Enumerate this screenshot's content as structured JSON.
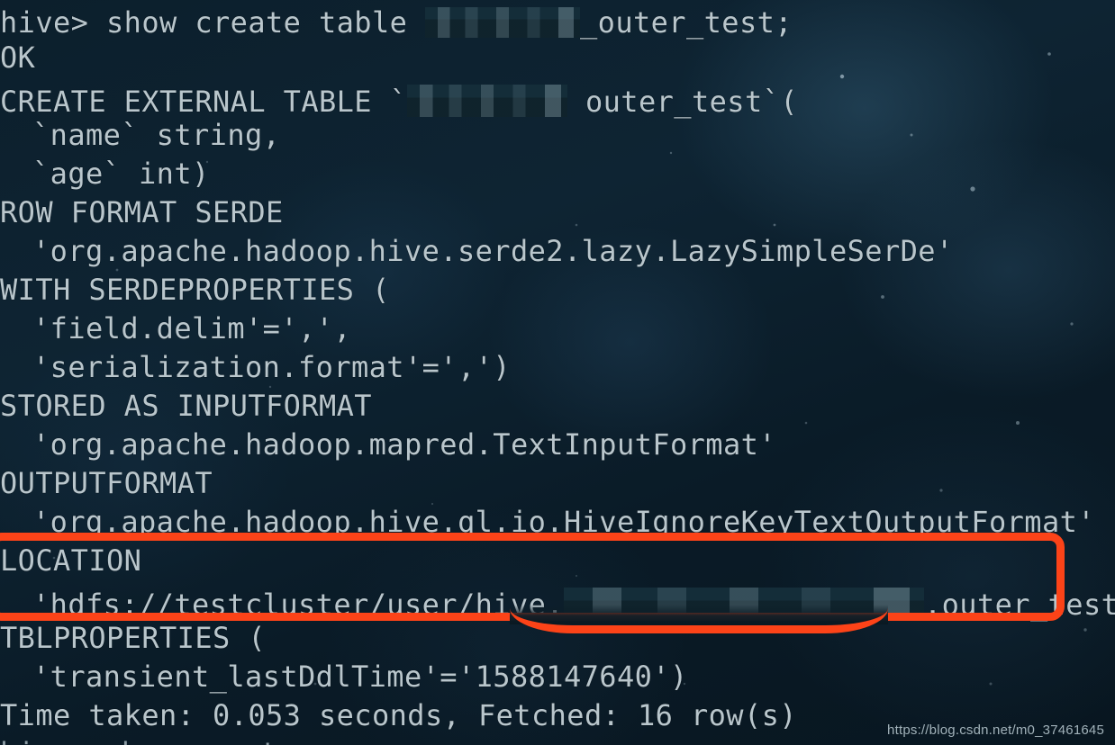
{
  "terminal": {
    "prompt": "hive> ",
    "lines": [
      {
        "id": "cmd-show-create",
        "indent": false,
        "pre": "hive> show create table ",
        "redacted": "m1",
        "post": "_outer_test;"
      },
      {
        "id": "result-ok",
        "indent": false,
        "pre": "OK",
        "redacted": null,
        "post": ""
      },
      {
        "id": "create-external-table",
        "indent": false,
        "pre": "CREATE EXTERNAL TABLE `",
        "redacted": "m2",
        "post": " outer_test`("
      },
      {
        "id": "col-name",
        "indent": true,
        "pre": "`name` string,",
        "redacted": null,
        "post": ""
      },
      {
        "id": "col-age",
        "indent": true,
        "pre": "`age` int)",
        "redacted": null,
        "post": ""
      },
      {
        "id": "row-format-serde",
        "indent": false,
        "pre": "ROW FORMAT SERDE",
        "redacted": null,
        "post": ""
      },
      {
        "id": "serde-class",
        "indent": true,
        "pre": "'org.apache.hadoop.hive.serde2.lazy.LazySimpleSerDe'",
        "redacted": null,
        "post": ""
      },
      {
        "id": "with-serdeproperties",
        "indent": false,
        "pre": "WITH SERDEPROPERTIES (",
        "redacted": null,
        "post": ""
      },
      {
        "id": "prop-field-delim",
        "indent": true,
        "pre": "'field.delim'=',',",
        "redacted": null,
        "post": ""
      },
      {
        "id": "prop-serialization-format",
        "indent": true,
        "pre": "'serialization.format'=',')",
        "redacted": null,
        "post": ""
      },
      {
        "id": "stored-as-inputformat",
        "indent": false,
        "pre": "STORED AS INPUTFORMAT",
        "redacted": null,
        "post": ""
      },
      {
        "id": "inputformat-class",
        "indent": true,
        "pre": "'org.apache.hadoop.mapred.TextInputFormat'",
        "redacted": null,
        "post": ""
      },
      {
        "id": "outputformat",
        "indent": false,
        "pre": "OUTPUTFORMAT",
        "redacted": null,
        "post": ""
      },
      {
        "id": "outputformat-class",
        "indent": true,
        "pre": "'org.apache.hadoop.hive.ql.io.HiveIgnoreKeyTextOutputFormat'",
        "redacted": null,
        "post": ""
      },
      {
        "id": "location-keyword",
        "indent": false,
        "pre": "LOCATION",
        "redacted": null,
        "post": ""
      },
      {
        "id": "location-path",
        "indent": true,
        "pre": "'hdfs://testcluster/user/hive,",
        "redacted": "m3",
        "post": ".outer_test'"
      },
      {
        "id": "tblproperties",
        "indent": false,
        "pre": "TBLPROPERTIES (",
        "redacted": null,
        "post": ""
      },
      {
        "id": "prop-transient-lastddltime",
        "indent": true,
        "pre": "'transient_lastDdlTime'='1588147640')",
        "redacted": null,
        "post": ""
      },
      {
        "id": "time-taken",
        "indent": false,
        "pre": "Time taken: 0.053 seconds, Fetched: 16 row(s)",
        "redacted": null,
        "post": ""
      }
    ],
    "cutoff_line": "hive> show create"
  },
  "highlight": {
    "label": "location-highlight",
    "color": "#fc4318"
  },
  "watermark": {
    "text": "https://blog.csdn.net/m0_37461645"
  },
  "colors": {
    "background": "#0d2130",
    "text": "#b9c6cc",
    "accent": "#fc4318",
    "redaction": "#16323f"
  }
}
